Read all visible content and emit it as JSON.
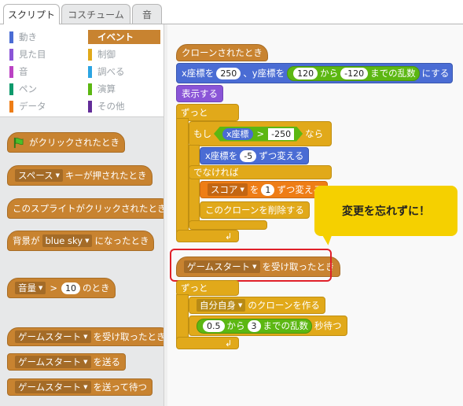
{
  "tabs": [
    "スクリプト",
    "コスチューム",
    "音"
  ],
  "categories": [
    {
      "label": "動き",
      "color": "#4a6cd4"
    },
    {
      "label": "イベント",
      "color": "#c88330",
      "selected": true
    },
    {
      "label": "見た目",
      "color": "#8a55d7"
    },
    {
      "label": "制御",
      "color": "#e1a91a"
    },
    {
      "label": "音",
      "color": "#bb42c3"
    },
    {
      "label": "調べる",
      "color": "#2ca5e2"
    },
    {
      "label": "ペン",
      "color": "#0e9a6c"
    },
    {
      "label": "演算",
      "color": "#5cb712"
    },
    {
      "label": "データ",
      "color": "#ee7d16"
    },
    {
      "label": "その他",
      "color": "#632d99"
    }
  ],
  "palette": {
    "flag_clicked": "がクリックされたとき",
    "key_dropdown": "スペース",
    "key_pressed": "キーが押されたとき",
    "sprite_clicked": "このスプライトがクリックされたとき",
    "backdrop_prefix": "背景が",
    "backdrop_value": "blue sky",
    "backdrop_suffix": "になったとき",
    "sensor_dropdown": "音量",
    "gt": ">",
    "sensor_value": "10",
    "sensor_suffix": "のとき",
    "msg_dropdown_1": "ゲームスタート",
    "receive_suffix": "を受け取ったとき",
    "msg_dropdown_2": "ゲームスタート",
    "broadcast_suffix": "を送る",
    "msg_dropdown_3": "ゲームスタート",
    "broadcast_wait_suffix": "を送って待つ"
  },
  "script1": {
    "hat": "クローンされたとき",
    "goto_prefix": "x座標を",
    "goto_x": "250",
    "goto_mid": "、y座標を",
    "rand_from": "120",
    "rand_mid": "から",
    "rand_to": "-120",
    "rand_suffix": "までの乱数",
    "goto_suffix": "にする",
    "show": "表示する",
    "forever": "ずっと",
    "if": "もし",
    "cond_left": "x座標",
    "cond_op": ">",
    "cond_right": "-250",
    "then": "なら",
    "change_x_prefix": "x座標を",
    "change_x_value": "-5",
    "change_x_suffix": "ずつ変える",
    "else": "でなければ",
    "var_dropdown": "スコア",
    "var_mid": "を",
    "var_value": "1",
    "var_suffix": "ずつ変える",
    "delete_clone": "このクローンを削除する"
  },
  "script2": {
    "hat_dropdown": "ゲームスタート",
    "hat_suffix": "を受け取ったとき",
    "forever": "ずっと",
    "clone_dropdown": "自分自身",
    "clone_suffix": "のクローンを作る",
    "wait_from": "0.5",
    "wait_mid": "から",
    "wait_to": "3",
    "wait_rand": "までの乱数",
    "wait_suffix": "秒待つ"
  },
  "callout": "変更を忘れずに！"
}
